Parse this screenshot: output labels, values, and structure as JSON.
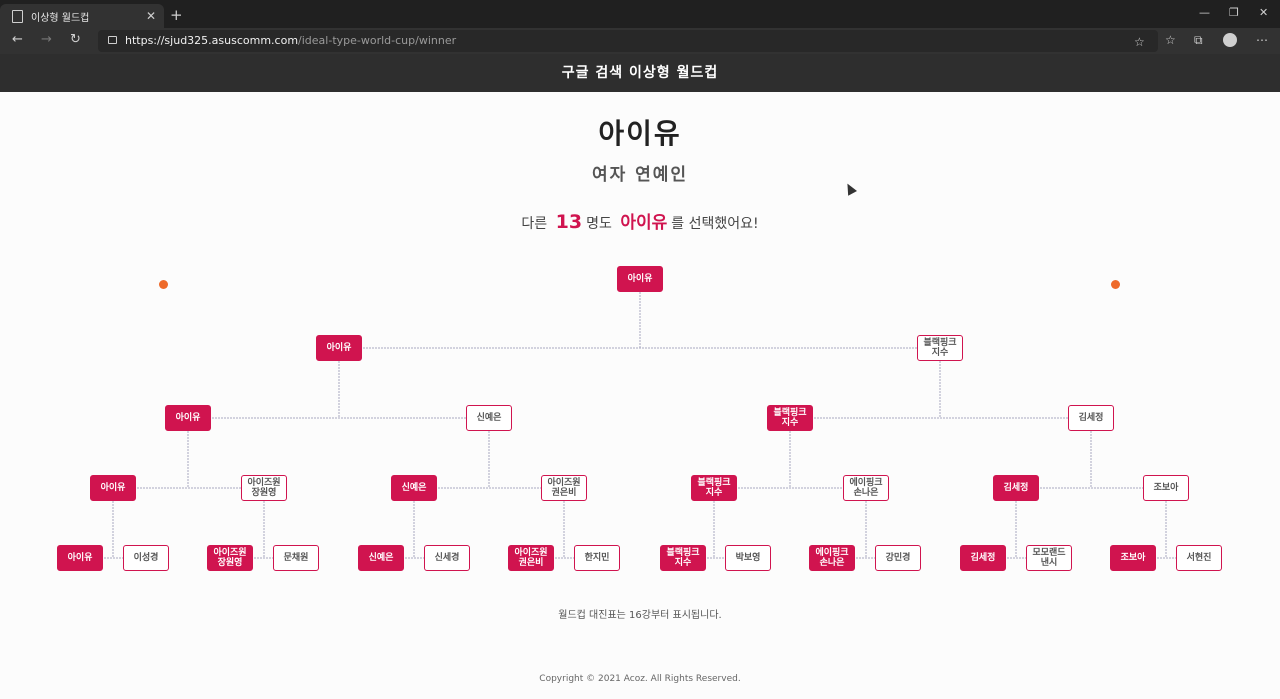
{
  "browser": {
    "tab_title": "이상형 월드컵",
    "url_host": "https://sjud325.asuscomm.com",
    "url_path": "/ideal-type-world-cup/winner"
  },
  "site": {
    "title": "구글 검색 이상형 월드컵"
  },
  "winner": {
    "name": "아이유",
    "category": "여자 연예인",
    "sentence_prefix": "다른",
    "count": "13",
    "sentence_mid": "명도",
    "sentence_name": "아이유",
    "sentence_suffix": "를 선택했어요!"
  },
  "bracket": {
    "final": "아이유",
    "semi": [
      "아이유",
      "블랙핑크\n지수"
    ],
    "quarter": [
      "아이유",
      "신예은",
      "블랙핑크\n지수",
      "김세정"
    ],
    "round8": [
      "아이유",
      "아이즈원\n장원영",
      "신예은",
      "아이즈원\n권은비",
      "블랙핑크\n지수",
      "에이핑크\n손나은",
      "김세정",
      "조보아"
    ],
    "round16": [
      "아이유",
      "이성경",
      "아이즈원\n장원영",
      "문채원",
      "신예은",
      "신세경",
      "아이즈원\n권은비",
      "한지민",
      "블랙핑크\n지수",
      "박보영",
      "에이핑크\n손나은",
      "강민경",
      "김세정",
      "모모랜드\n낸시",
      "조보아",
      "서현진"
    ],
    "round16_winners": [
      true,
      false,
      true,
      false,
      true,
      false,
      true,
      false,
      true,
      false,
      true,
      false,
      true,
      false,
      true,
      false
    ],
    "round8_winners": [
      true,
      false,
      true,
      false,
      true,
      false,
      true,
      false
    ],
    "quarter_winners": [
      true,
      false,
      true,
      false
    ],
    "semi_winners": [
      true,
      false
    ],
    "win_color": "#d0144f"
  },
  "footer": {
    "note": "월드컵 대진표는 16강부터 표시됩니다.",
    "copyright": "Copyright © 2021 Acoz. All Rights Reserved."
  }
}
